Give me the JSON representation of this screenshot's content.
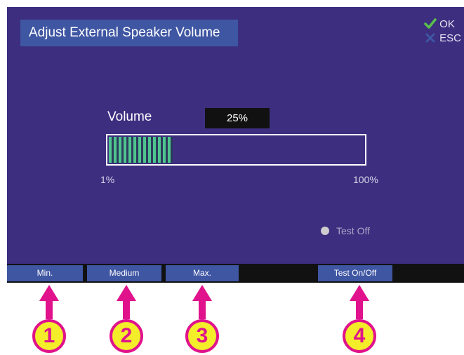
{
  "window": {
    "title": "Adjust External Speaker Volume"
  },
  "header_actions": {
    "ok_label": "OK",
    "esc_label": "ESC",
    "ok_icon": "check-icon",
    "esc_icon": "x-icon"
  },
  "volume": {
    "label": "Volume",
    "value_text": "25%",
    "fill_fraction": 0.25,
    "scale_min": "1%",
    "scale_max": "100%"
  },
  "test_status": {
    "label": "Test Off"
  },
  "softkeys": [
    {
      "label": "Min."
    },
    {
      "label": "Medium"
    },
    {
      "label": "Max."
    },
    {
      "label": "Test On/Off"
    }
  ],
  "callouts": [
    {
      "number": "1"
    },
    {
      "number": "2"
    },
    {
      "number": "3"
    },
    {
      "number": "4"
    }
  ],
  "colors": {
    "screen_bg": "#3d2e80",
    "title_bg": "#3f56a3",
    "meter_fill": "#4fc48e",
    "ok_check": "#58c24a",
    "esc_x": "#3f56a3",
    "callout_arrow": "#e0138c",
    "callout_fill": "#f4ee2a"
  }
}
